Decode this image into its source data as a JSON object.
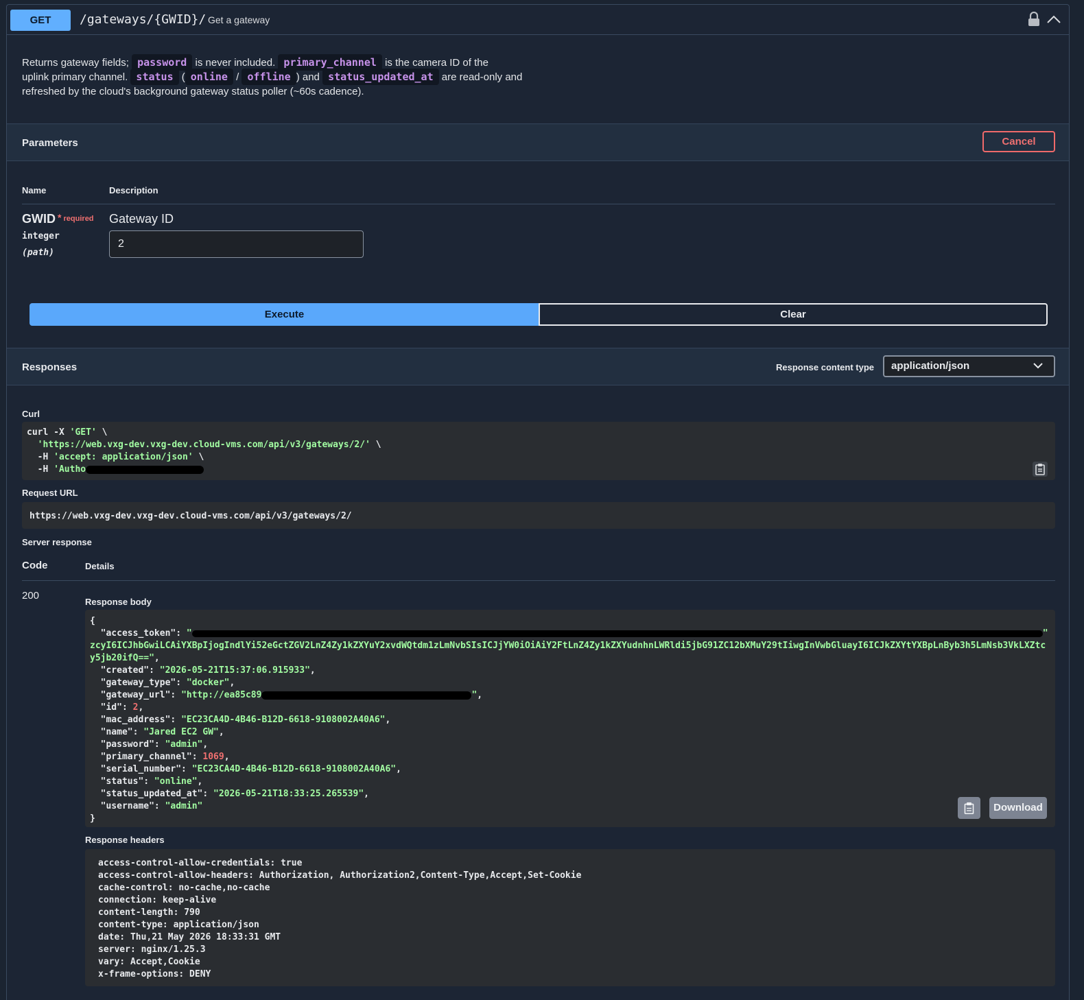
{
  "operation": {
    "method": "GET",
    "path": "/gateways/{GWID}/",
    "summary": "Get a gateway"
  },
  "description": {
    "t1": "Returns gateway fields;",
    "c1": "password",
    "t2": "is never included.",
    "c2": "primary_channel",
    "t3": "is the camera ID of the",
    "t4": "uplink primary channel.",
    "c3": "status",
    "t5": "(",
    "c4": "online",
    "t6": "/",
    "c5": "offline",
    "t7": ") and",
    "c6": "status_updated_at",
    "t8": "are read-only and",
    "t9": "refreshed by the cloud's background gateway status poller (~60s cadence)."
  },
  "parameters": {
    "title": "Parameters",
    "cancel_label": "Cancel",
    "col_name": "Name",
    "col_description": "Description",
    "param": {
      "name": "GWID",
      "required_star": "*",
      "required_label": "required",
      "type": "integer",
      "in": "(path)",
      "description": "Gateway ID",
      "value": "2"
    }
  },
  "actions": {
    "execute_label": "Execute",
    "clear_label": "Clear"
  },
  "responses": {
    "title": "Responses",
    "content_type_label": "Response content type",
    "content_type_value": "application/json",
    "curl_label": "Curl",
    "curl": {
      "l1a": "curl -X ",
      "l1b": "'GET'",
      "l1c": " \\",
      "l2a": "  ",
      "l2b": "'https://web.vxg-dev.vxg-dev.cloud-vms.com/api/v3/gateways/2/'",
      "l2c": " \\",
      "l3a": "  -H ",
      "l3b": "'accept: application/json'",
      "l3c": " \\",
      "l4a": "  -H ",
      "l4b": "'Autho"
    },
    "request_url_label": "Request URL",
    "request_url": "https://web.vxg-dev.vxg-dev.cloud-vms.com/api/v3/gateways/2/",
    "server_response_label": "Server response",
    "col_code": "Code",
    "col_details": "Details",
    "code": "200",
    "body_label": "Response body",
    "body": {
      "open": "{",
      "access_token_key": "  \"access_token\": ",
      "access_token_start": "\"",
      "access_token_l2": "zcyI6ICJhbGwiLCAiYXBpIjogIndlYi52eGctZGV2LnZ4Zy1kZXYuY2xvdWQtdm1zLmNvbSIsICJjYW0iOiAiY2FtLnZ4Zy1kZXYudnhnLWRldi5jbG91ZC12bXMuY29tIiwgInVwbGluayI6ICJkZXYtYXBpLnByb3h5LmNsb3VkLXZtc",
      "access_token_l3": "y5jb20ifQ==\"",
      "created_key": "  \"created\": ",
      "created": "\"2026-05-21T15:37:06.915933\"",
      "gateway_type_key": "  \"gateway_type\": ",
      "gateway_type": "\"docker\"",
      "gateway_url_key": "  \"gateway_url\": ",
      "gateway_url": "\"http://ea85c89",
      "gateway_url_end": "\"",
      "id_key": "  \"id\": ",
      "id": "2",
      "mac_key": "  \"mac_address\": ",
      "mac": "\"EC23CA4D-4B46-B12D-6618-9108002A40A6\"",
      "name_key": "  \"name\": ",
      "name": "\"Jared EC2 GW\"",
      "password_key": "  \"password\": ",
      "password": "\"admin\"",
      "primary_channel_key": "  \"primary_channel\": ",
      "primary_channel": "1069",
      "serial_key": "  \"serial_number\": ",
      "serial": "\"EC23CA4D-4B46-B12D-6618-9108002A40A6\"",
      "status_key": "  \"status\": ",
      "status": "\"online\"",
      "status_updated_key": "  \"status_updated_at\": ",
      "status_updated": "\"2026-05-21T18:33:25.265539\"",
      "username_key": "  \"username\": ",
      "username": "\"admin\"",
      "close": "}"
    },
    "download_label": "Download",
    "headers_label": "Response headers",
    "headers": [
      "access-control-allow-credentials: true",
      "access-control-allow-headers: Authorization, Authorization2,Content-Type,Accept,Set-Cookie",
      "cache-control: no-cache,no-cache",
      "connection: keep-alive",
      "content-length: 790",
      "content-type: application/json",
      "date: Thu,21 May 2026 18:33:31 GMT",
      "server: nginx/1.25.3",
      "vary: Accept,Cookie",
      "x-frame-options: DENY"
    ]
  },
  "colors": {
    "get_method": "#61affe",
    "cancel": "#f06a6a",
    "string_value": "#a2fca2",
    "number_value": "#f07070",
    "inline_code": "#c792ea"
  },
  "icons": {
    "lock": "lock-icon",
    "collapse": "chevron-up-icon",
    "select": "chevron-down-icon",
    "copy": "clipboard-icon"
  }
}
